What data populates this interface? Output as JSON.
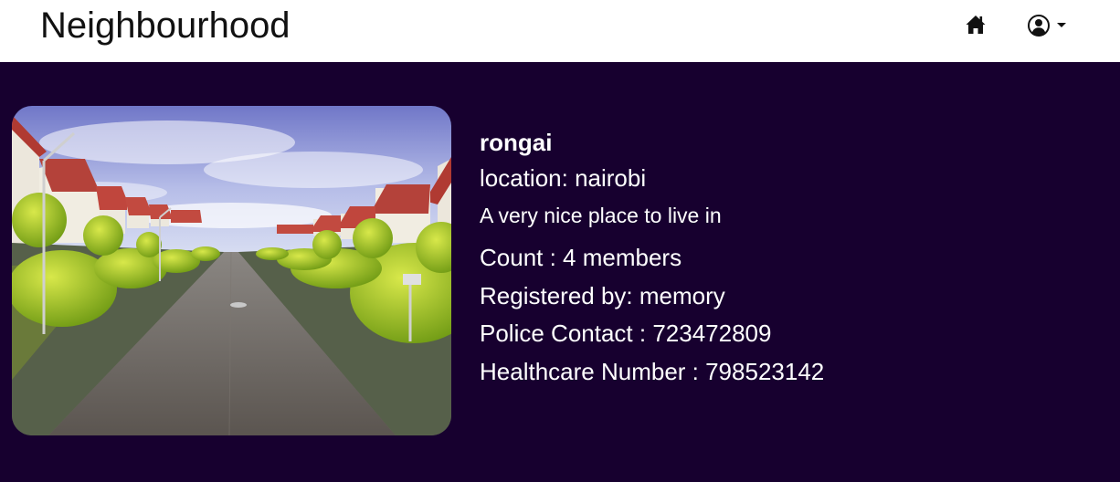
{
  "navbar": {
    "brand": "Neighbourhood",
    "home_icon": "home-icon",
    "user_icon": "user-circle-icon",
    "dropdown_icon": "caret-down-icon"
  },
  "neighbourhood": {
    "image_icon": "neighbourhood-photo",
    "name": "rongai",
    "location": "location: nairobi",
    "description": "A very nice place to live in",
    "count": "Count : 4 members",
    "registered_by": "Registered by: memory",
    "police_contact": "Police Contact : 723472809",
    "healthcare_number": "Healthcare Number : 798523142"
  },
  "colors": {
    "navbar_bg": "#ffffff",
    "page_bg": "#17002f",
    "text_light": "#ffffff",
    "text_dark": "#111111"
  }
}
